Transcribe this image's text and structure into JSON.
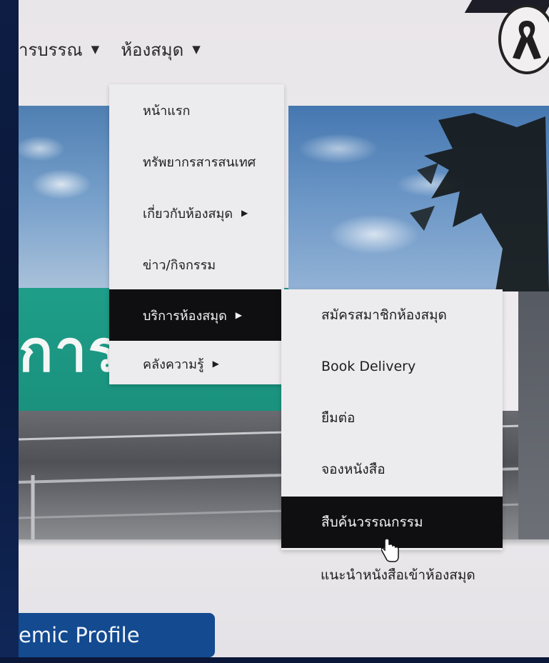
{
  "topnav": {
    "items": [
      {
        "label": "ารบรรณ"
      },
      {
        "label": "ห้องสมุด"
      }
    ]
  },
  "hero": {
    "title": "การ"
  },
  "menu": {
    "items": [
      {
        "label": "หน้าแรก",
        "has_submenu": false
      },
      {
        "label": "ทรัพยากรสารสนเทศ",
        "has_submenu": false
      },
      {
        "label": "เกี่ยวกับห้องสมุด",
        "has_submenu": true
      },
      {
        "label": "ข่าว/กิจกรรม",
        "has_submenu": false
      },
      {
        "label": "บริการห้องสมุด",
        "has_submenu": true,
        "active": true
      },
      {
        "label": "คลังความรู้",
        "has_submenu": true
      }
    ]
  },
  "submenu": {
    "items": [
      {
        "label": "สมัครสมาชิกห้องสมุด"
      },
      {
        "label": "Book Delivery"
      },
      {
        "label": "ยืมต่อ"
      },
      {
        "label": "จองหนังสือ"
      },
      {
        "label": "สืบค้นวรรณกรรม",
        "active": true
      },
      {
        "label": "แนะนำหนังสือเข้าห้องสมุด"
      }
    ]
  },
  "profile_button": {
    "label": "lemic Profile"
  },
  "icons": {
    "caret": "▼",
    "arrow": "▶",
    "badge": "ribbon-icon",
    "cursor": "hand-pointer-icon"
  },
  "colors": {
    "accent_teal": "#1e9e89",
    "button_blue": "#134a90",
    "menu_active": "#0f0f12",
    "menu_bg": "#ecebee"
  }
}
